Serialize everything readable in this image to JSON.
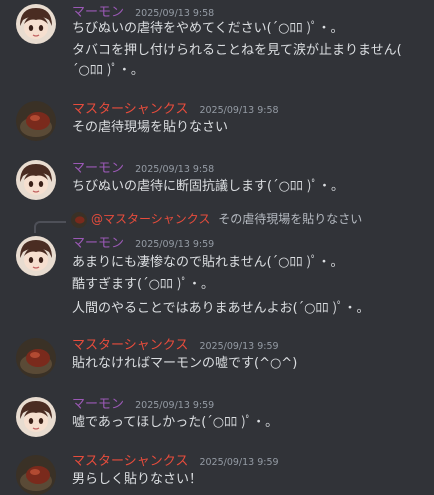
{
  "colors": {
    "background": "#313338",
    "marmon_name": "#9b59b6",
    "master_name": "#e74c3c",
    "text": "#dbdee1",
    "timestamp": "#949ba4"
  },
  "messages": [
    {
      "author": "マーモン",
      "time": "2025/09/13 9:58",
      "lines": [
        "ちびぬいの虐待をやめてください(´○ﾛﾛ )ﾟ・。",
        "タバコを押し付けられることねを見て涙が止まりません(",
        "´○ﾛﾛ )ﾟ・。"
      ]
    },
    {
      "author": "マスターシャンクス",
      "time": "2025/09/13 9:58",
      "lines": [
        "その虐待現場を貼りなさい"
      ]
    },
    {
      "author": "マーモン",
      "time": "2025/09/13 9:58",
      "lines": [
        "ちびぬいの虐待に断固抗議します(´○ﾛﾛ )ﾟ・。"
      ]
    },
    {
      "author": "マーモン",
      "time": "2025/09/13 9:59",
      "reply": {
        "author": "@マスターシャンクス",
        "text": "その虐待現場を貼りなさい"
      },
      "lines": [
        "あまりにも凄惨なので貼れません(´○ﾛﾛ )ﾟ・。",
        "酷すぎます(´○ﾛﾛ )ﾟ・。",
        "人間のやることではありまあせんよお(´○ﾛﾛ )ﾟ・。"
      ]
    },
    {
      "author": "マスターシャンクス",
      "time": "2025/09/13 9:59",
      "lines": [
        "貼れなければマーモンの嘘です(^○^)"
      ]
    },
    {
      "author": "マーモン",
      "time": "2025/09/13 9:59",
      "lines": [
        "嘘であってほしかった(´○ﾛﾛ )ﾟ・。"
      ]
    },
    {
      "author": "マスターシャンクス",
      "time": "2025/09/13 9:59",
      "lines": [
        "男らしく貼りなさい！"
      ]
    }
  ]
}
